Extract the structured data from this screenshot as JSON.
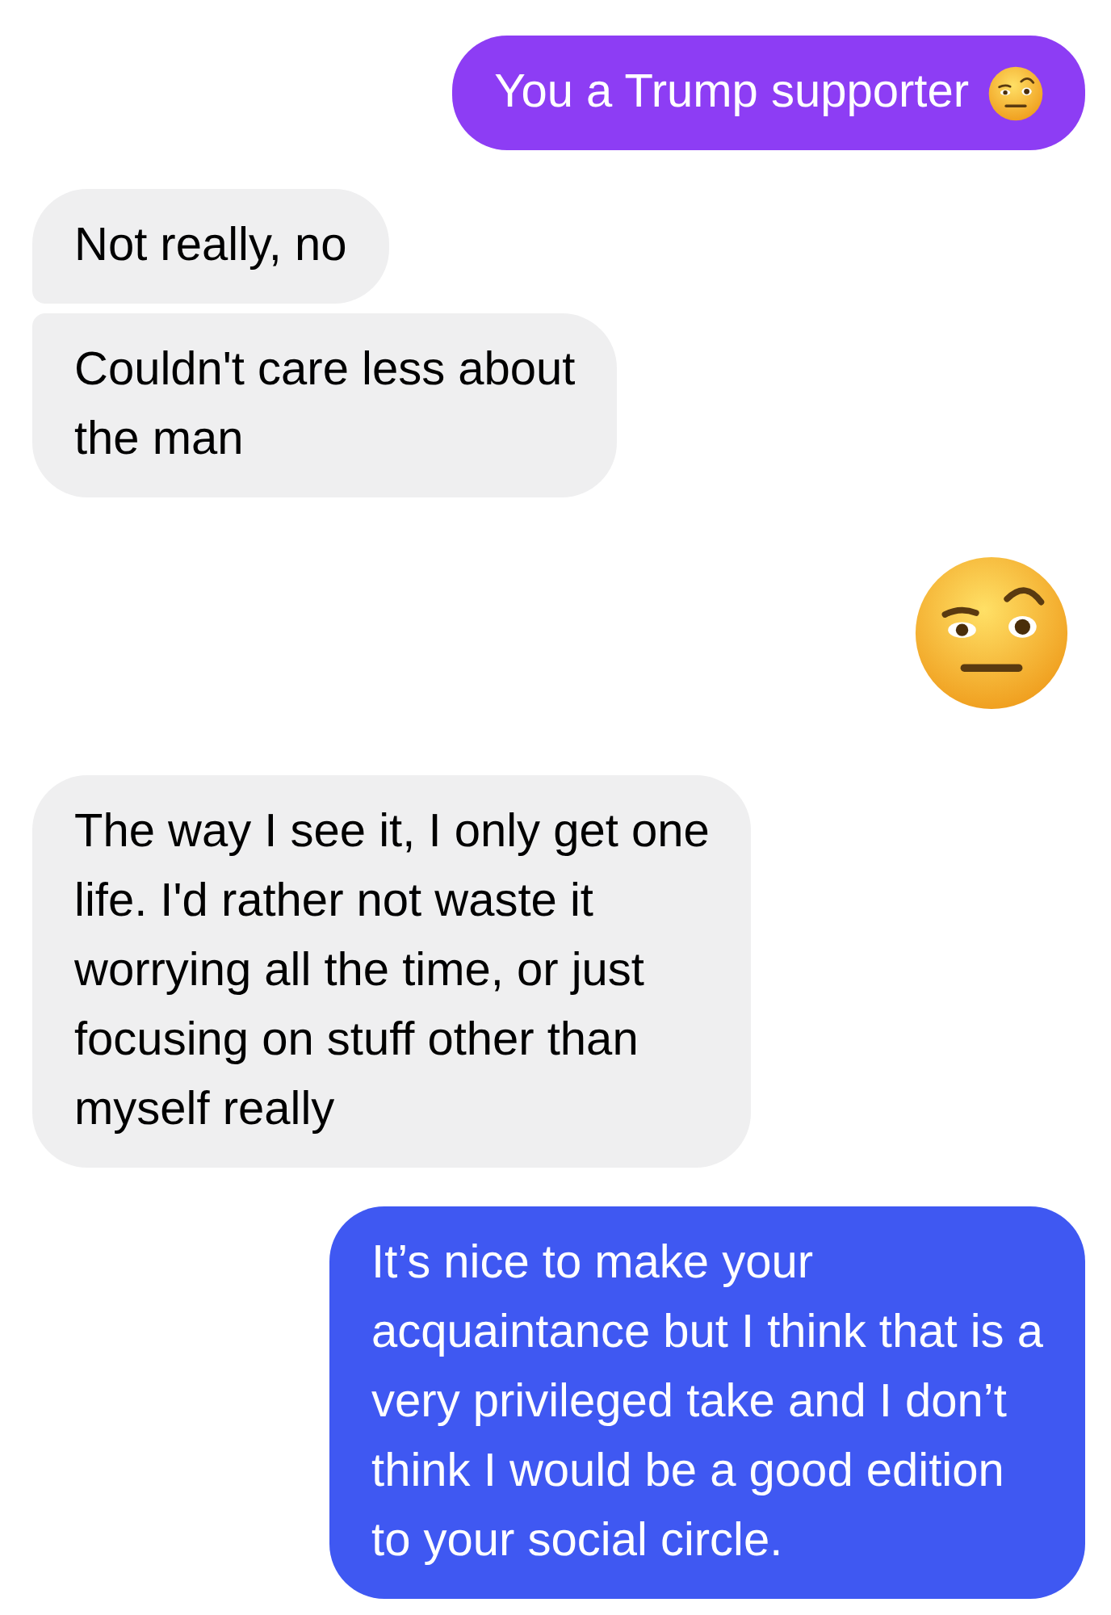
{
  "messages": [
    {
      "kind": "text",
      "outgoing": true,
      "color": "#8d3df4",
      "text": "You a Trump supporter",
      "has_emoji": true
    },
    {
      "kind": "text",
      "outgoing": false,
      "text": "Not really, no"
    },
    {
      "kind": "text",
      "outgoing": false,
      "text": "Couldn't care less about\nthe man"
    },
    {
      "kind": "emoji",
      "outgoing": true
    },
    {
      "kind": "text",
      "outgoing": false,
      "text": "The way I see it, I only get one\nlife. I'd rather not waste it\nworrying all the time, or just\nfocusing on stuff other than\nmyself really"
    },
    {
      "kind": "text",
      "outgoing": true,
      "color": "#3f58f2",
      "text": "It’s nice to make your\nacquaintance but I think that is a\nvery privileged take and I don’t\nthink I would be a good edition\nto your social circle."
    }
  ]
}
